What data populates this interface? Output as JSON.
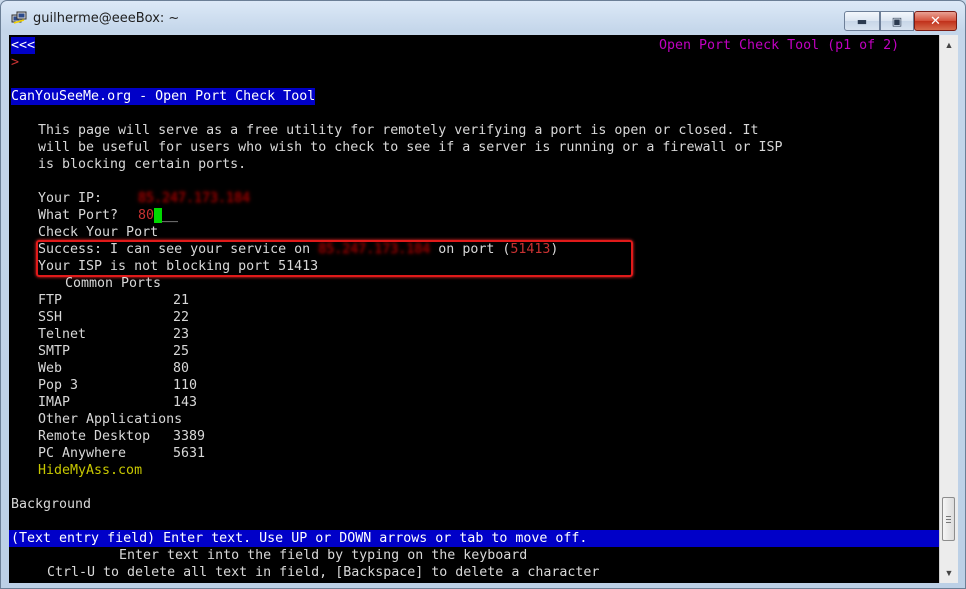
{
  "window": {
    "title": "guilherme@eeeBox: ~",
    "controls": {
      "minimize": "▬",
      "maximize": "▣",
      "close": "✕"
    }
  },
  "terminal": {
    "nav_back": "<<<",
    "prompt_marker": ">",
    "page_header": "Open Port Check Tool (p1 of 2)",
    "site_heading": "CanYouSeeMe.org - Open Port Check Tool",
    "intro": [
      "This page will serve as a free utility for remotely verifying a port is open or closed. It",
      "will be useful for users who wish to check to see if a server is running or a firewall or ISP",
      "is blocking certain ports."
    ],
    "ip_label": "Your IP:",
    "ip_value": "85.247.173.184",
    "port_label": "What Port?",
    "port_value": "80",
    "port_field_rest": "__",
    "check_button": "Check Your Port",
    "success_prefix": "Success: I can see your service on",
    "success_ip": "85.247.173.184",
    "success_mid": "on port (",
    "success_port": "51413",
    "success_suffix": ")",
    "isp_message": "Your ISP is not blocking port 51413",
    "common_ports_heading": "Common Ports",
    "common_ports": [
      {
        "name": "FTP",
        "port": "21"
      },
      {
        "name": "SSH",
        "port": "22"
      },
      {
        "name": "Telnet",
        "port": "23"
      },
      {
        "name": "SMTP",
        "port": "25"
      },
      {
        "name": "Web",
        "port": "80"
      },
      {
        "name": "Pop 3",
        "port": "110"
      },
      {
        "name": "IMAP",
        "port": "143"
      }
    ],
    "other_apps_heading": "Other Applications",
    "other_apps": [
      {
        "name": "Remote Desktop",
        "port": "3389"
      },
      {
        "name": "PC Anywhere",
        "port": "5631"
      }
    ],
    "footer_link": "HideMyAss.com",
    "background_label": "Background",
    "status_bar": "(Text entry field) Enter text. Use UP or DOWN arrows or tab to move off.",
    "help_line_1": "Enter text into the field by typing on the keyboard",
    "help_line_2": "Ctrl-U to delete all text in field, [Backspace] to delete a character"
  },
  "colors": {
    "terminal_bg": "#000000",
    "text": "#d8d8d8",
    "highlight_bg": "#0000c8",
    "magenta": "#c100c1",
    "red_box": "#e01a1a",
    "cursor_green": "#00d800",
    "link_yellow": "#c8c800"
  },
  "icons": {
    "app": "putty-icon",
    "scroll_up": "chevron-up-icon",
    "scroll_down": "chevron-down-icon"
  }
}
